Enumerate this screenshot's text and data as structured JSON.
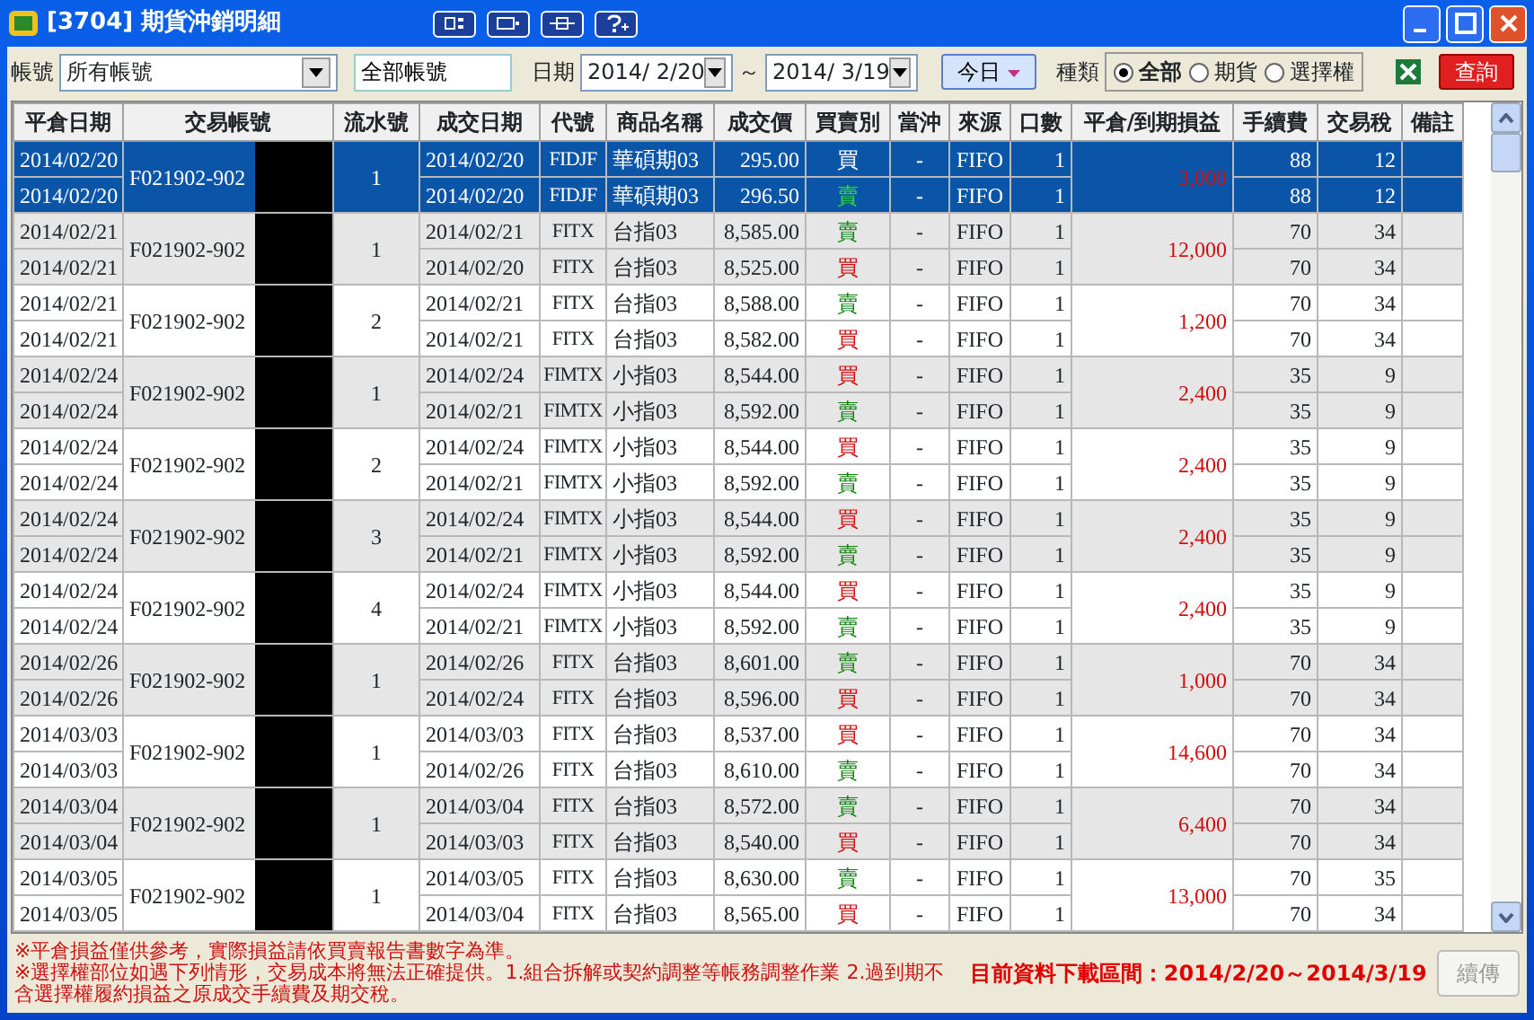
{
  "window": {
    "title": "[3704] 期貨沖銷明細"
  },
  "toolbar": {
    "account_label": "帳號",
    "account_select": "所有帳號",
    "account_field": "全部帳號",
    "date_label": "日期",
    "date_from": "2014/ 2/20",
    "date_sep": "～",
    "date_to": "2014/ 3/19",
    "today_button": "今日",
    "type_label": "種類",
    "types": [
      {
        "label": "全部",
        "selected": true
      },
      {
        "label": "期貨",
        "selected": false
      },
      {
        "label": "選擇權",
        "selected": false
      }
    ],
    "query_button": "查詢"
  },
  "table": {
    "columns": [
      "平倉日期",
      "交易帳號",
      "流水號",
      "成交日期",
      "代號",
      "商品名稱",
      "成交價",
      "買賣別",
      "當沖",
      "來源",
      "口數",
      "平倉/到期損益",
      "手續費",
      "交易稅",
      "備註"
    ],
    "groups": [
      {
        "close_dates": [
          "2014/02/20",
          "2014/02/20"
        ],
        "account": "F021902-902",
        "seq": "1",
        "pnl": "3,000",
        "selected": true,
        "legs": [
          {
            "date": "2014/02/20",
            "code": "FIDJF",
            "name": "華碩期03",
            "price": "295.00",
            "side": "買",
            "kind": "buy",
            "daytrade": "-",
            "source": "FIFO",
            "qty": "1",
            "fee": "88",
            "tax": "12"
          },
          {
            "date": "2014/02/20",
            "code": "FIDJF",
            "name": "華碩期03",
            "price": "296.50",
            "side": "賣",
            "kind": "sell",
            "daytrade": "-",
            "source": "FIFO",
            "qty": "1",
            "fee": "88",
            "tax": "12"
          }
        ]
      },
      {
        "close_dates": [
          "2014/02/21",
          "2014/02/21"
        ],
        "account": "F021902-902",
        "seq": "1",
        "pnl": "12,000",
        "selected": false,
        "legs": [
          {
            "date": "2014/02/21",
            "code": "FITX",
            "name": "台指03",
            "price": "8,585.00",
            "side": "賣",
            "kind": "sell",
            "daytrade": "-",
            "source": "FIFO",
            "qty": "1",
            "fee": "70",
            "tax": "34"
          },
          {
            "date": "2014/02/20",
            "code": "FITX",
            "name": "台指03",
            "price": "8,525.00",
            "side": "買",
            "kind": "buy",
            "daytrade": "-",
            "source": "FIFO",
            "qty": "1",
            "fee": "70",
            "tax": "34"
          }
        ]
      },
      {
        "close_dates": [
          "2014/02/21",
          "2014/02/21"
        ],
        "account": "F021902-902",
        "seq": "2",
        "pnl": "1,200",
        "selected": false,
        "legs": [
          {
            "date": "2014/02/21",
            "code": "FITX",
            "name": "台指03",
            "price": "8,588.00",
            "side": "賣",
            "kind": "sell",
            "daytrade": "-",
            "source": "FIFO",
            "qty": "1",
            "fee": "70",
            "tax": "34"
          },
          {
            "date": "2014/02/21",
            "code": "FITX",
            "name": "台指03",
            "price": "8,582.00",
            "side": "買",
            "kind": "buy",
            "daytrade": "-",
            "source": "FIFO",
            "qty": "1",
            "fee": "70",
            "tax": "34"
          }
        ]
      },
      {
        "close_dates": [
          "2014/02/24",
          "2014/02/24"
        ],
        "account": "F021902-902",
        "seq": "1",
        "pnl": "2,400",
        "selected": false,
        "legs": [
          {
            "date": "2014/02/24",
            "code": "FIMTX",
            "name": "小指03",
            "price": "8,544.00",
            "side": "買",
            "kind": "buy",
            "daytrade": "-",
            "source": "FIFO",
            "qty": "1",
            "fee": "35",
            "tax": "9"
          },
          {
            "date": "2014/02/21",
            "code": "FIMTX",
            "name": "小指03",
            "price": "8,592.00",
            "side": "賣",
            "kind": "sell",
            "daytrade": "-",
            "source": "FIFO",
            "qty": "1",
            "fee": "35",
            "tax": "9"
          }
        ]
      },
      {
        "close_dates": [
          "2014/02/24",
          "2014/02/24"
        ],
        "account": "F021902-902",
        "seq": "2",
        "pnl": "2,400",
        "selected": false,
        "legs": [
          {
            "date": "2014/02/24",
            "code": "FIMTX",
            "name": "小指03",
            "price": "8,544.00",
            "side": "買",
            "kind": "buy",
            "daytrade": "-",
            "source": "FIFO",
            "qty": "1",
            "fee": "35",
            "tax": "9"
          },
          {
            "date": "2014/02/21",
            "code": "FIMTX",
            "name": "小指03",
            "price": "8,592.00",
            "side": "賣",
            "kind": "sell",
            "daytrade": "-",
            "source": "FIFO",
            "qty": "1",
            "fee": "35",
            "tax": "9"
          }
        ]
      },
      {
        "close_dates": [
          "2014/02/24",
          "2014/02/24"
        ],
        "account": "F021902-902",
        "seq": "3",
        "pnl": "2,400",
        "selected": false,
        "legs": [
          {
            "date": "2014/02/24",
            "code": "FIMTX",
            "name": "小指03",
            "price": "8,544.00",
            "side": "買",
            "kind": "buy",
            "daytrade": "-",
            "source": "FIFO",
            "qty": "1",
            "fee": "35",
            "tax": "9"
          },
          {
            "date": "2014/02/21",
            "code": "FIMTX",
            "name": "小指03",
            "price": "8,592.00",
            "side": "賣",
            "kind": "sell",
            "daytrade": "-",
            "source": "FIFO",
            "qty": "1",
            "fee": "35",
            "tax": "9"
          }
        ]
      },
      {
        "close_dates": [
          "2014/02/24",
          "2014/02/24"
        ],
        "account": "F021902-902",
        "seq": "4",
        "pnl": "2,400",
        "selected": false,
        "legs": [
          {
            "date": "2014/02/24",
            "code": "FIMTX",
            "name": "小指03",
            "price": "8,544.00",
            "side": "買",
            "kind": "buy",
            "daytrade": "-",
            "source": "FIFO",
            "qty": "1",
            "fee": "35",
            "tax": "9"
          },
          {
            "date": "2014/02/21",
            "code": "FIMTX",
            "name": "小指03",
            "price": "8,592.00",
            "side": "賣",
            "kind": "sell",
            "daytrade": "-",
            "source": "FIFO",
            "qty": "1",
            "fee": "35",
            "tax": "9"
          }
        ]
      },
      {
        "close_dates": [
          "2014/02/26",
          "2014/02/26"
        ],
        "account": "F021902-902",
        "seq": "1",
        "pnl": "1,000",
        "selected": false,
        "legs": [
          {
            "date": "2014/02/26",
            "code": "FITX",
            "name": "台指03",
            "price": "8,601.00",
            "side": "賣",
            "kind": "sell",
            "daytrade": "-",
            "source": "FIFO",
            "qty": "1",
            "fee": "70",
            "tax": "34"
          },
          {
            "date": "2014/02/24",
            "code": "FITX",
            "name": "台指03",
            "price": "8,596.00",
            "side": "買",
            "kind": "buy",
            "daytrade": "-",
            "source": "FIFO",
            "qty": "1",
            "fee": "70",
            "tax": "34"
          }
        ]
      },
      {
        "close_dates": [
          "2014/03/03",
          "2014/03/03"
        ],
        "account": "F021902-902",
        "seq": "1",
        "pnl": "14,600",
        "selected": false,
        "legs": [
          {
            "date": "2014/03/03",
            "code": "FITX",
            "name": "台指03",
            "price": "8,537.00",
            "side": "買",
            "kind": "buy",
            "daytrade": "-",
            "source": "FIFO",
            "qty": "1",
            "fee": "70",
            "tax": "34"
          },
          {
            "date": "2014/02/26",
            "code": "FITX",
            "name": "台指03",
            "price": "8,610.00",
            "side": "賣",
            "kind": "sell",
            "daytrade": "-",
            "source": "FIFO",
            "qty": "1",
            "fee": "70",
            "tax": "34"
          }
        ]
      },
      {
        "close_dates": [
          "2014/03/04",
          "2014/03/04"
        ],
        "account": "F021902-902",
        "seq": "1",
        "pnl": "6,400",
        "selected": false,
        "legs": [
          {
            "date": "2014/03/04",
            "code": "FITX",
            "name": "台指03",
            "price": "8,572.00",
            "side": "賣",
            "kind": "sell",
            "daytrade": "-",
            "source": "FIFO",
            "qty": "1",
            "fee": "70",
            "tax": "34"
          },
          {
            "date": "2014/03/03",
            "code": "FITX",
            "name": "台指03",
            "price": "8,540.00",
            "side": "買",
            "kind": "buy",
            "daytrade": "-",
            "source": "FIFO",
            "qty": "1",
            "fee": "70",
            "tax": "34"
          }
        ]
      },
      {
        "close_dates": [
          "2014/03/05",
          "2014/03/05"
        ],
        "account": "F021902-902",
        "seq": "1",
        "pnl": "13,000",
        "selected": false,
        "legs": [
          {
            "date": "2014/03/05",
            "code": "FITX",
            "name": "台指03",
            "price": "8,630.00",
            "side": "賣",
            "kind": "sell",
            "daytrade": "-",
            "source": "FIFO",
            "qty": "1",
            "fee": "70",
            "tax": "35"
          },
          {
            "date": "2014/03/04",
            "code": "FITX",
            "name": "台指03",
            "price": "8,565.00",
            "side": "買",
            "kind": "buy",
            "daytrade": "-",
            "source": "FIFO",
            "qty": "1",
            "fee": "70",
            "tax": "34"
          }
        ]
      }
    ]
  },
  "footer": {
    "notes": [
      "※平倉損益僅供參考，實際損益請依買賣報告書數字為準。",
      "※選擇權部位如遇下列情形，交易成本將無法正確提供。1.組合拆解或契約調整等帳務調整作業 2.過到期不含選擇權履約損益之原成交手續費及期交稅。"
    ],
    "range": "目前資料下載區間：2014/2/20～2014/3/19",
    "continue_button": {
      "label": "續傳",
      "disabled": true
    }
  }
}
